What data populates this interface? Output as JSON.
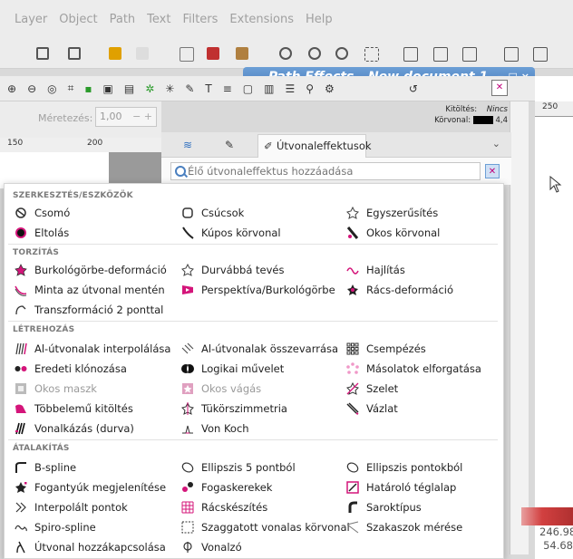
{
  "menu": [
    "Layer",
    "Object",
    "Path",
    "Text",
    "Filters",
    "Extensions",
    "Help"
  ],
  "window_title": "Path Effects - New document 1",
  "window_controls": "− □ ×",
  "sizing": {
    "label": "Méretezés:",
    "value": "1,00",
    "buttons": "− +"
  },
  "stroke_info": {
    "fill_label": "Kitöltés:",
    "fill_value": "Nincs",
    "stroke_label": "Körvonal:",
    "stroke_width": "4,4"
  },
  "ruler_left": [
    "150",
    "200"
  ],
  "ruler_right": "250",
  "tab_active": "Útvonaleffektusok",
  "tab_close": "×",
  "search_placeholder": "Élő útvonaleffektus hozzáadása",
  "coords": {
    "x": "246.98",
    "y": "54.68"
  },
  "accent_color": "#4a7fbf",
  "effect_color": "#d4157a",
  "categories": [
    {
      "title": "SZERKESZTÉS/ESZKÖZÖK",
      "items": [
        {
          "label": "Csomó",
          "icon": "knot-icon"
        },
        {
          "label": "Csúcsok",
          "icon": "corners-icon"
        },
        {
          "label": "Egyszerűsítés",
          "icon": "simplify-icon"
        },
        {
          "label": "Eltolás",
          "icon": "offset-icon"
        },
        {
          "label": "Kúpos körvonal",
          "icon": "taper-stroke-icon"
        },
        {
          "label": "Okos körvonal",
          "icon": "power-stroke-icon"
        }
      ]
    },
    {
      "title": "TORZÍTÁS",
      "items": [
        {
          "label": "Burkológörbe-deformáció",
          "icon": "envelope-deform-icon"
        },
        {
          "label": "Durvábbá tevés",
          "icon": "roughen-icon"
        },
        {
          "label": "Hajlítás",
          "icon": "bend-icon"
        },
        {
          "label": "Minta az útvonal mentén",
          "icon": "pattern-along-path-icon"
        },
        {
          "label": "Perspektíva/Burkológörbe",
          "icon": "perspective-icon"
        },
        {
          "label": "Rács-deformáció",
          "icon": "lattice-deform-icon"
        },
        {
          "label": "Transzformáció 2 ponttal",
          "icon": "transform-2pts-icon"
        }
      ]
    },
    {
      "title": "LÉTREHOZÁS",
      "items": [
        {
          "label": "Al-útvonalak interpolálása",
          "icon": "interpolate-subpaths-icon"
        },
        {
          "label": "Al-útvonalak összevarrása",
          "icon": "stitch-subpaths-icon"
        },
        {
          "label": "Csempézés",
          "icon": "tiling-icon"
        },
        {
          "label": "Eredeti klónozása",
          "icon": "clone-original-icon"
        },
        {
          "label": "Logikai művelet",
          "icon": "boolean-op-icon"
        },
        {
          "label": "Másolatok elforgatása",
          "icon": "rotate-copies-icon"
        },
        {
          "label": "Okos maszk",
          "icon": "power-mask-icon",
          "dim": true
        },
        {
          "label": "Okos vágás",
          "icon": "power-clip-icon",
          "dim": true
        },
        {
          "label": "Szelet",
          "icon": "slice-icon"
        },
        {
          "label": "Többelemű kitöltés",
          "icon": "fill-between-many-icon"
        },
        {
          "label": "Tükörszimmetria",
          "icon": "mirror-symmetry-icon"
        },
        {
          "label": "Vázlat",
          "icon": "sketch-icon"
        },
        {
          "label": "Vonalkázás (durva)",
          "icon": "hatches-icon"
        },
        {
          "label": "Von Koch",
          "icon": "von-koch-icon"
        }
      ]
    },
    {
      "title": "ÁTALAKÍTÁS",
      "items": [
        {
          "label": "B-spline",
          "icon": "bspline-icon"
        },
        {
          "label": "Ellipszis 5 pontból",
          "icon": "ellipse-5pts-icon"
        },
        {
          "label": "Ellipszis pontokból",
          "icon": "ellipse-from-points-icon"
        },
        {
          "label": "Fogantyúk megjelenítése",
          "icon": "show-handles-icon"
        },
        {
          "label": "Fogaskerekek",
          "icon": "gears-icon"
        },
        {
          "label": "Határoló téglalap",
          "icon": "bounding-box-icon"
        },
        {
          "label": "Interpolált pontok",
          "icon": "interpolate-points-icon"
        },
        {
          "label": "Rácskészítés",
          "icon": "construct-grid-icon"
        },
        {
          "label": "Saroktípus",
          "icon": "join-type-icon"
        },
        {
          "label": "Spiro-spline",
          "icon": "spiro-spline-icon"
        },
        {
          "label": "Szaggatott vonalas körvonal",
          "icon": "dashed-stroke-icon"
        },
        {
          "label": "Szakaszok mérése",
          "icon": "measure-segments-icon"
        },
        {
          "label": "Útvonal hozzákapcsolása",
          "icon": "attach-path-icon"
        },
        {
          "label": "Vonalzó",
          "icon": "ruler-icon"
        }
      ]
    }
  ]
}
